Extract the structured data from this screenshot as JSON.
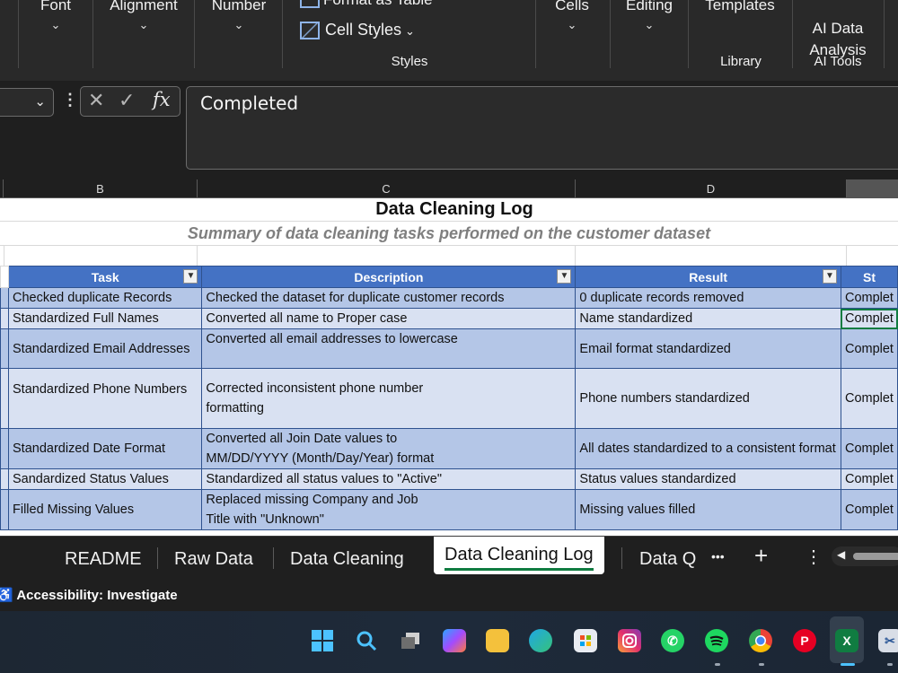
{
  "ribbon": {
    "groups": [
      "Font",
      "Alignment",
      "Number",
      "Cells",
      "Editing",
      "Templates",
      "AI Data\nAnalysis"
    ],
    "cell_styles": "Cell Styles",
    "format_table": "Format as Table",
    "label_styles": "Styles",
    "label_library": "Library",
    "label_ai_tools": "AI Tools"
  },
  "formula_bar": {
    "fx": "fx",
    "value": "Completed"
  },
  "columns": [
    "B",
    "C",
    "D"
  ],
  "sheet": {
    "title": "Data Cleaning Log",
    "subtitle": "Summary of data cleaning tasks performed on the customer dataset",
    "headers": [
      "Task",
      "Description",
      "Result",
      "St"
    ],
    "rows": [
      {
        "task": "Checked duplicate Records",
        "desc": "Checked the dataset for duplicate customer records",
        "result": "0 duplicate records removed",
        "status": "Complet"
      },
      {
        "task": "Standardized Full Names",
        "desc": "Converted all name to Proper case",
        "result": "Name standardized",
        "status": "Complet"
      },
      {
        "task": "Standardized Email Addresses",
        "desc": "Converted all email addresses to lowercase",
        "result": "Email format standardized",
        "status": "Complet"
      },
      {
        "task": "Standardized Phone Numbers",
        "desc": "Corrected inconsistent phone number formatting",
        "result": "Phone numbers standardized",
        "status": "Complet"
      },
      {
        "task": "Standardized Date Format",
        "desc": "Converted all  Join Date values to MM/DD/YYYY (Month/Day/Year) format",
        "result": "All dates standardized to a consistent format",
        "status": "Complet"
      },
      {
        "task": "Sandardized Status Values",
        "desc": "Standardized all status values to \"Active\"",
        "result": "Status values standardized",
        "status": "Complet"
      },
      {
        "task": "Filled Missing Values",
        "desc": "Replaced missing Company and Job Title with \"Unknown\"",
        "result": "Missing values filled",
        "status": "Complet"
      }
    ]
  },
  "tabs": [
    "README",
    "Raw Data",
    "Data Cleaning",
    "Data Cleaning Log",
    "Data Q"
  ],
  "tab_controls": {
    "more": "•••",
    "add": "+",
    "menu": "⋮"
  },
  "status": {
    "accessibility": "Accessibility: Investigate"
  },
  "taskbar_icons": [
    "windows-start",
    "search",
    "task-view",
    "copilot",
    "file-explorer",
    "edge",
    "microsoft-store",
    "instagram",
    "whatsapp",
    "spotify",
    "chrome",
    "pinterest",
    "excel",
    "snipping-tool"
  ]
}
